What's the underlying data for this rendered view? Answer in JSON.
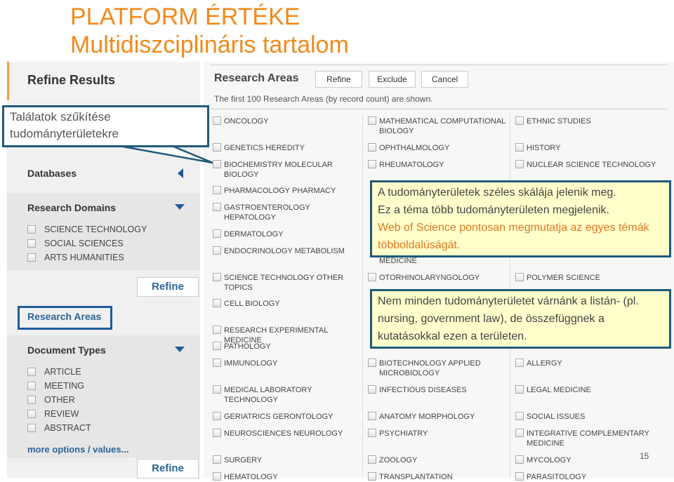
{
  "slide": {
    "title": "PLATFORM ÉRTÉKE",
    "subtitle": "Multidiszciplináris tartalom",
    "page_number": "15",
    "accent": "#f08a1c"
  },
  "sidebar": {
    "header": "Refine Results",
    "databases": "Databases",
    "research_domains": "Research Domains",
    "domain_items": [
      "SCIENCE TECHNOLOGY",
      "SOCIAL SCIENCES",
      "ARTS HUMANITIES"
    ],
    "refine_label": "Refine",
    "research_areas": "Research Areas",
    "document_types": "Document Types",
    "doc_items": [
      "ARTICLE",
      "MEETING",
      "OTHER",
      "REVIEW",
      "ABSTRACT"
    ],
    "more_options": "more options / values..."
  },
  "main": {
    "title": "Research Areas",
    "buttons": [
      "Refine",
      "Exclude",
      "Cancel"
    ],
    "note": "The first 100 Research Areas (by record count) are shown.",
    "col1": [
      "ONCOLOGY",
      "GENETICS HEREDITY",
      "BIOCHEMISTRY MOLECULAR BIOLOGY",
      "PHARMACOLOGY PHARMACY",
      "GASTROENTEROLOGY HEPATOLOGY",
      "DERMATOLOGY",
      "ENDOCRINOLOGY METABOLISM",
      "SCIENCE TECHNOLOGY OTHER TOPICS",
      "CELL BIOLOGY",
      "RESEARCH EXPERIMENTAL MEDICINE",
      "PATHOLOGY",
      "IMMUNOLOGY",
      "MEDICAL LABORATORY TECHNOLOGY",
      "GERIATRICS GERONTOLOGY",
      "NEUROSCIENCES NEUROLOGY",
      "SURGERY",
      "HEMATOLOGY"
    ],
    "col2": [
      "MATHEMATICAL COMPUTATIONAL BIOLOGY",
      "OPHTHALMOLOGY",
      "RHEUMATOLOGY",
      "MEDICINE",
      "OTORHINOLARYNGOLOGY",
      "BIOTECHNOLOGY APPLIED MICROBIOLOGY",
      "INFECTIOUS DISEASES",
      "ANATOMY MORPHOLOGY",
      "PSYCHIATRY",
      "ZOOLOGY",
      "TRANSPLANTATION"
    ],
    "col3": [
      "ETHNIC STUDIES",
      "HISTORY",
      "NUCLEAR SCIENCE TECHNOLOGY",
      "POLYMER SCIENCE",
      "ALLERGY",
      "LEGAL MEDICINE",
      "SOCIAL ISSUES",
      "INTEGRATIVE COMPLEMENTARY MEDICINE",
      "MYCOLOGY",
      "PARASITOLOGY"
    ]
  },
  "callouts": {
    "left": "Találatok szűkítése tudományterületekre",
    "c1_line1": "A tudományterületek széles skálája jelenik meg.",
    "c1_line2": "Ez a téma több tudományterületen megjelenik.",
    "c1_highlight": "Web of Science pontosan megmutatja az egyes témák  többoldalúságát.",
    "c2": "Nem minden tudományterületet várnánk a listán- (pl. nursing, government law), de összefüggnek a kutatásokkal ezen a területen."
  }
}
